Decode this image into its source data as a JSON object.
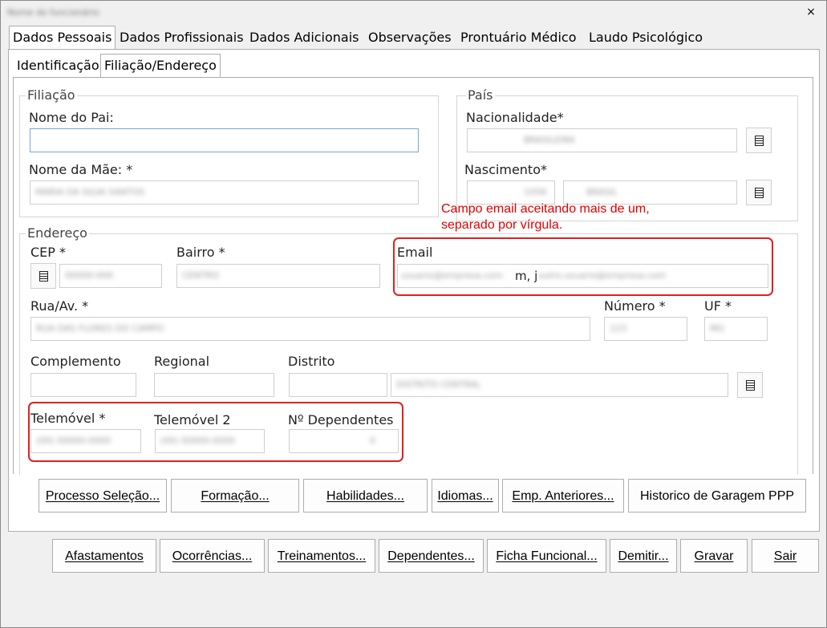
{
  "window": {
    "title_blurred": "Nome do funcionário",
    "close_glyph": "×"
  },
  "main_tabs": [
    {
      "label": "Dados Pessoais"
    },
    {
      "label": "Dados Profissionais"
    },
    {
      "label": "Dados Adicionais"
    },
    {
      "label": "Observações"
    },
    {
      "label": "Prontuário Médico"
    },
    {
      "label": "Laudo Psicológico"
    }
  ],
  "sub_tabs": [
    {
      "label": "Identificação"
    },
    {
      "label": "Filiação/Endereço"
    }
  ],
  "filiacao": {
    "legend": "Filiação",
    "pai_label": "Nome do Pai:",
    "pai_value": "",
    "mae_label": "Nome da Mãe:  *",
    "mae_value": "MARIA DA SILVA SANTOS"
  },
  "pais": {
    "legend": "País",
    "nacionalidade_label": "Nacionalidade*",
    "nacionalidade_value": "BRASILEIRA",
    "nascimento_label": "Nascimento*",
    "nascimento_code": "1058",
    "nascimento_value": "BRASIL"
  },
  "endereco": {
    "legend": "Endereço",
    "cep_label": "CEP *",
    "cep_value": "00000-000",
    "bairro_label": "Bairro *",
    "bairro_value": "CENTRO",
    "email_label": "Email",
    "email_value_a": "usuario@empresa.com",
    "email_sep": "m, j",
    "email_value_b": "outro.usuario@empresa.com",
    "rua_label": "Rua/Av. *",
    "rua_value": "RUA DAS FLORES DO CAMPO",
    "numero_label": "Número *",
    "numero_value": "123",
    "uf_label": "UF *",
    "uf_value": "MG",
    "complemento_label": "Complemento",
    "regional_label": "Regional",
    "distrito_label": "Distrito",
    "distrito_value": "DISTRITO CENTRAL",
    "telemovel_label": "Telemóvel *",
    "telemovel_value": "(00) 00000-0000",
    "telemovel2_label": "Telemóvel 2",
    "telemovel2_value": "(00) 00000-0000",
    "dependentes_label": "Nº Dependentes",
    "dependentes_value": "0"
  },
  "annotation": {
    "line1": "Campo email aceitando mais de um,",
    "line2": "separado por vírgula."
  },
  "row1_buttons": [
    {
      "label": "Processo Seleção..."
    },
    {
      "label": "Formação..."
    },
    {
      "label": "Habilidades..."
    },
    {
      "label": "Idiomas..."
    },
    {
      "label": "Emp. Anteriores..."
    },
    {
      "label": "Historico de Garagem PPP"
    }
  ],
  "row2_buttons": [
    {
      "label": "Afastamentos"
    },
    {
      "label": "Ocorrências..."
    },
    {
      "label": "Treinamentos..."
    },
    {
      "label": "Dependentes..."
    },
    {
      "label": "Ficha Funcional..."
    },
    {
      "label": "Demitir..."
    },
    {
      "label": "Gravar"
    },
    {
      "label": "Sair"
    }
  ],
  "colors": {
    "annotation_red": "#e00000",
    "focus_border": "#7aa7d6"
  }
}
